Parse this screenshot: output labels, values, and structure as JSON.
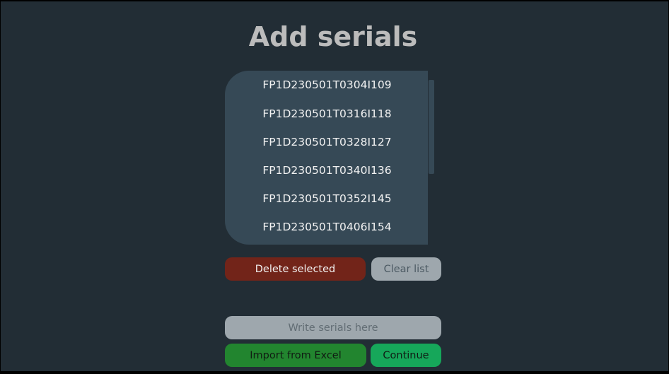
{
  "page": {
    "title": "Add serials"
  },
  "serials": {
    "items": [
      "FP1D230501T0304I109",
      "FP1D230501T0316I118",
      "FP1D230501T0328I127",
      "FP1D230501T0340I136",
      "FP1D230501T0352I145",
      "FP1D230501T0406I154"
    ]
  },
  "actions": {
    "delete_selected_label": "Delete selected",
    "clear_list_label": "Clear list",
    "import_excel_label": "Import from Excel",
    "continue_label": "Continue"
  },
  "input": {
    "value": "",
    "placeholder": "Write serials here"
  },
  "colors": {
    "background": "#222d35",
    "list_background": "#364956",
    "delete": "#722419",
    "neutral": "#9ea7ad",
    "import": "#22852f",
    "continue": "#16a75a",
    "title": "#bcbcbc"
  }
}
